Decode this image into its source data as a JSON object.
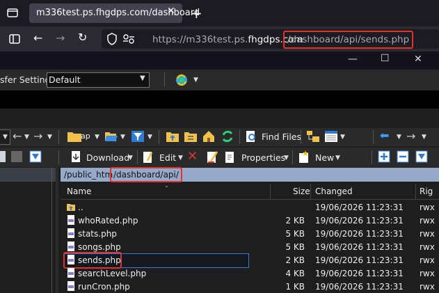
{
  "browser": {
    "tab_title": "m336test.ps.fhgdps.com/dashboard",
    "url_prefix": "https://m336test.ps.",
    "url_host_bold": "fhgdps.com",
    "url_path": "/dashboard/api/sends.php",
    "new_tab_label": "+",
    "close_tab_label": "✕"
  },
  "window": {
    "minimize": "—",
    "maximize": "☐",
    "close": "✕"
  },
  "toolbar1": {
    "transfer_label": "sfer Settings",
    "transfer_value": "Default"
  },
  "toolbar2": {
    "find_files_label": "Find Files",
    "folder_label": "ap"
  },
  "toolbar3": {
    "download_label": "Download",
    "edit_label": "Edit",
    "properties_label": "Properties",
    "new_label": "New"
  },
  "path": {
    "static": "/public_htm",
    "highlight": "/dashboard/api/"
  },
  "columns": {
    "name": "Name",
    "size": "Size",
    "changed": "Changed",
    "rights": "Rig"
  },
  "files": [
    {
      "name": "..",
      "size": "",
      "changed": "19/06/2026 11:23:31",
      "rights": "rwx"
    },
    {
      "name": "whoRated.php",
      "size": "2 KB",
      "changed": "19/06/2026 11:23:31",
      "rights": "rwx"
    },
    {
      "name": "stats.php",
      "size": "5 KB",
      "changed": "19/06/2026 11:23:31",
      "rights": "rwx"
    },
    {
      "name": "songs.php",
      "size": "5 KB",
      "changed": "19/06/2026 11:23:31",
      "rights": "rwx"
    },
    {
      "name": "sends.php",
      "size": "2 KB",
      "changed": "19/06/2026 11:23:31",
      "rights": "rwx"
    },
    {
      "name": "searchLevel.php",
      "size": "4 KB",
      "changed": "19/06/2026 11:23:31",
      "rights": "rwx"
    },
    {
      "name": "runCron.php",
      "size": "1 KB",
      "changed": "19/06/2026 11:23:31",
      "rights": "rwx"
    }
  ],
  "colors": {
    "highlight_red": "#e2322e",
    "path_bar": "#97a9c9",
    "selection_border": "#3a7bd5"
  }
}
